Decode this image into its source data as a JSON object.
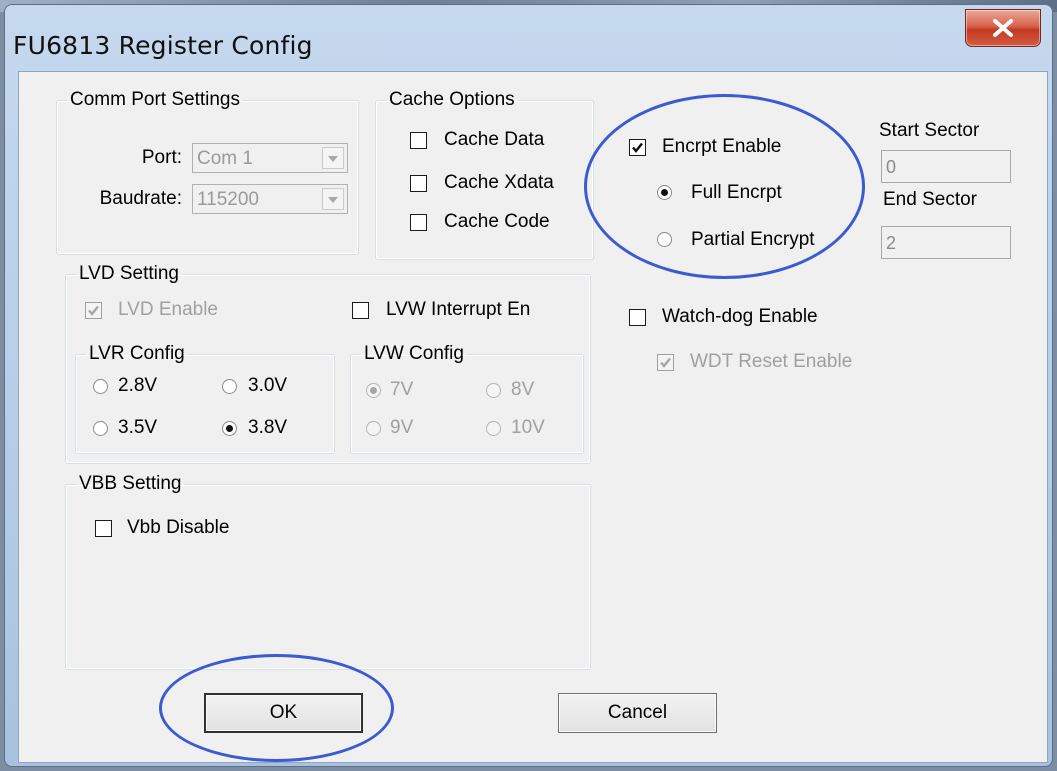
{
  "window": {
    "title": "FU6813 Register Config",
    "close_glyph": "close-icon"
  },
  "comm_port": {
    "legend": "Comm Port Settings",
    "port_label": "Port:",
    "port_value": "Com 1",
    "baud_label": "Baudrate:",
    "baud_value": "115200"
  },
  "cache": {
    "legend": "Cache Options",
    "data": "Cache Data",
    "xdata": "Cache Xdata",
    "code": "Cache Code"
  },
  "encrypt": {
    "enable": "Encrpt Enable",
    "full": "Full Encrpt",
    "partial": "Partial Encrypt",
    "start_label": "Start Sector",
    "start_value": "0",
    "end_label": "End Sector",
    "end_value": "2"
  },
  "lvd": {
    "legend": "LVD Setting",
    "enable": "LVD Enable",
    "lvw_int": "LVW Interrupt En",
    "lvr_legend": "LVR Config",
    "lvr": [
      "2.8V",
      "3.0V",
      "3.5V",
      "3.8V"
    ],
    "lvw_legend": "LVW Config",
    "lvw": [
      "7V",
      "8V",
      "9V",
      "10V"
    ]
  },
  "watchdog": {
    "enable": "Watch-dog Enable",
    "reset": "WDT Reset Enable"
  },
  "vbb": {
    "legend": "VBB Setting",
    "disable": "Vbb Disable"
  },
  "buttons": {
    "ok": "OK",
    "cancel": "Cancel"
  },
  "colors": {
    "highlight_ellipse": "#3b5bd0",
    "close_button": "#c23b22"
  }
}
